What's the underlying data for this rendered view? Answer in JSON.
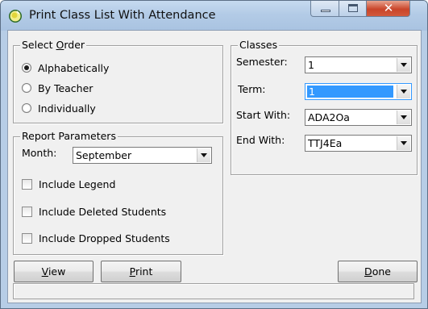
{
  "window": {
    "title": "Print Class List With Attendance",
    "close_glyph": "✕"
  },
  "select_order": {
    "legend": "Select Order",
    "legend_hotkey": "O",
    "options": [
      {
        "label": "Alphabetically",
        "checked": true
      },
      {
        "label": "By Teacher",
        "checked": false
      },
      {
        "label": "Individually",
        "checked": false
      }
    ]
  },
  "report_parameters": {
    "legend": "Report Parameters",
    "month_label": "Month:",
    "month_value": "September",
    "checkboxes": [
      {
        "label": "Include Legend",
        "checked": false
      },
      {
        "label": "Include Deleted Students",
        "checked": false
      },
      {
        "label": "Include Dropped Students",
        "checked": false
      }
    ]
  },
  "classes": {
    "legend": "Classes",
    "semester_label": "Semester:",
    "semester_value": "1",
    "term_label": "Term:",
    "term_value": "1",
    "start_label": "Start With:",
    "start_value": "ADA2Oa",
    "end_label": "End With:",
    "end_value": "TTJ4Ea"
  },
  "buttons": {
    "view": "View",
    "view_hotkey": "V",
    "print": "Print",
    "print_hotkey": "P",
    "done": "Done",
    "done_hotkey": "D"
  },
  "status_text": ""
}
